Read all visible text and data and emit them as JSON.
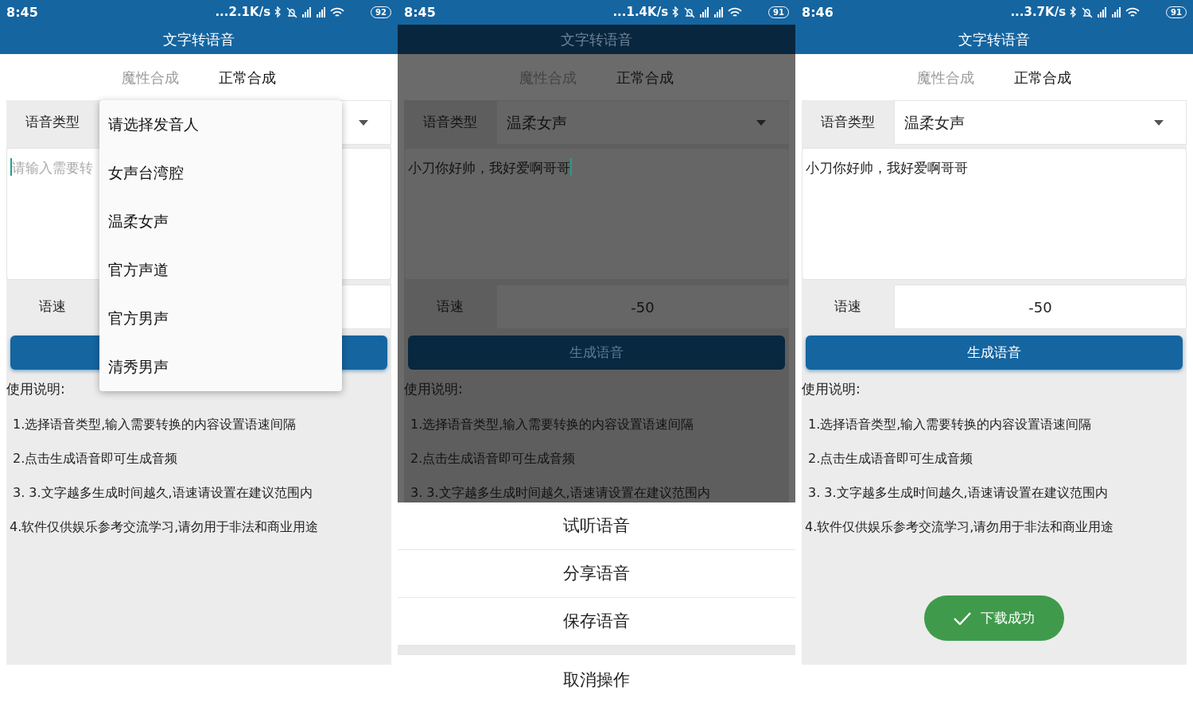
{
  "screens": [
    {
      "dimmed": false,
      "status": {
        "time": "8:45",
        "speed": "...2.1K/s",
        "battery": "92"
      },
      "title": "文字转语音",
      "tabs": [
        {
          "label": "魔性合成",
          "selected": false
        },
        {
          "label": "正常合成",
          "selected": true
        }
      ],
      "voice": {
        "label": "语音类型"
      },
      "text_area": {
        "placeholder": "请输入需要转",
        "focused": true
      },
      "speed": {
        "label": "语速"
      },
      "instructions": {
        "title": "使用说明:",
        "lines": [
          "1.选择语音类型,输入需要转换的内容设置语速间隔",
          "2.点击生成语音即可生成音频",
          "3. 3.文字越多生成时间越久,语速请设置在建议范围内",
          "4.软件仅供娱乐参考交流学习,请勿用于非法和商业用途"
        ]
      },
      "overlay": {
        "kind": "dropdown",
        "items": [
          "请选择发音人",
          "女声台湾腔",
          "温柔女声",
          "官方声道",
          "官方男声",
          "清秀男声"
        ]
      }
    },
    {
      "dimmed": true,
      "status": {
        "time": "8:45",
        "speed": "...1.4K/s",
        "battery": "91"
      },
      "title": "文字转语音",
      "tabs": [
        {
          "label": "魔性合成",
          "selected": false
        },
        {
          "label": "正常合成",
          "selected": true
        }
      ],
      "voice": {
        "label": "语音类型",
        "value": "温柔女声"
      },
      "text_area": {
        "value": "小刀你好帅，我好爱啊哥哥",
        "focused": true
      },
      "speed": {
        "label": "语速",
        "value": "-50"
      },
      "button": {
        "label": "生成语音"
      },
      "instructions": {
        "title": "使用说明:",
        "lines": [
          "1.选择语音类型,输入需要转换的内容设置语速间隔",
          "2.点击生成语音即可生成音频",
          "3. 3.文字越多生成时间越久,语速请设置在建议范围内"
        ]
      },
      "overlay": {
        "kind": "action_sheet",
        "items": [
          "试听语音",
          "分享语音",
          "保存语音"
        ],
        "cancel": "取消操作"
      }
    },
    {
      "dimmed": false,
      "status": {
        "time": "8:46",
        "speed": "...3.7K/s",
        "battery": "91"
      },
      "title": "文字转语音",
      "tabs": [
        {
          "label": "魔性合成",
          "selected": false
        },
        {
          "label": "正常合成",
          "selected": true
        }
      ],
      "voice": {
        "label": "语音类型",
        "value": "温柔女声"
      },
      "text_area": {
        "value": "小刀你好帅，我好爱啊哥哥",
        "focused": false
      },
      "speed": {
        "label": "语速",
        "value": "-50"
      },
      "button": {
        "label": "生成语音"
      },
      "instructions": {
        "title": "使用说明:",
        "lines": [
          "1.选择语音类型,输入需要转换的内容设置语速间隔",
          "2.点击生成语音即可生成音频",
          "3. 3.文字越多生成时间越久,语速请设置在建议范围内",
          "4.软件仅供娱乐参考交流学习,请勿用于非法和商业用途"
        ]
      },
      "overlay": {
        "kind": "toast",
        "text": "下载成功"
      }
    }
  ]
}
